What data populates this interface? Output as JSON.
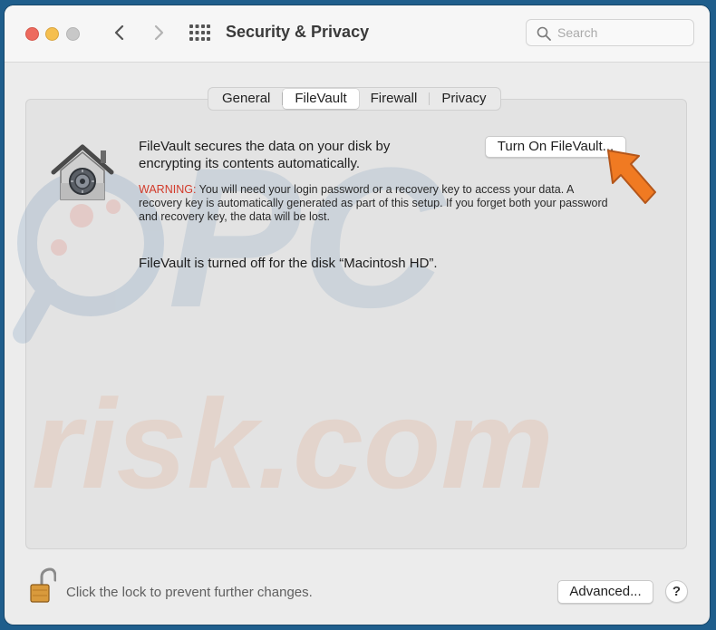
{
  "window": {
    "title": "Security & Privacy"
  },
  "search": {
    "placeholder": "Search",
    "value": ""
  },
  "tabs": [
    {
      "label": "General",
      "active": false
    },
    {
      "label": "FileVault",
      "active": true
    },
    {
      "label": "Firewall",
      "active": false
    },
    {
      "label": "Privacy",
      "active": false
    }
  ],
  "filevault": {
    "description": "FileVault secures the data on your disk by encrypting its contents automatically.",
    "turn_on_label": "Turn On FileVault...",
    "warning_label": "WARNING:",
    "warning_text": " You will need your login password or a recovery key to access your data. A recovery key is automatically generated as part of this setup. If you forget both your password and recovery key, the data will be lost.",
    "status": "FileVault is turned off for the disk “Macintosh HD”."
  },
  "footer": {
    "lock_text": "Click the lock to prevent further changes.",
    "advanced_label": "Advanced...",
    "help_label": "?"
  },
  "watermark": {
    "text_top": "PC",
    "text_bottom": "risk.com"
  },
  "icons": {
    "close": "close-icon",
    "minimize": "minimize-icon",
    "zoom": "zoom-icon",
    "back": "chevron-left-icon",
    "forward": "chevron-right-icon",
    "grid": "grid-icon",
    "search": "search-icon",
    "filevault": "filevault-house-icon",
    "lock": "lock-open-icon",
    "arrow": "pointer-arrow-icon"
  },
  "colors": {
    "warning": "#d23a2a",
    "arrow": "#f07a22",
    "window_bg": "#ececec"
  }
}
